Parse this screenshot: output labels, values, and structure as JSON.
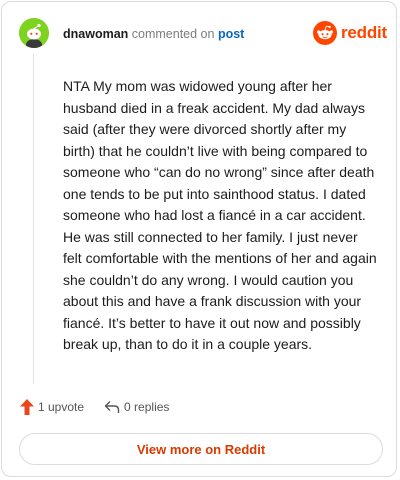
{
  "header": {
    "username": "dnawoman",
    "action_text": "commented on",
    "post_link": "post"
  },
  "brand": {
    "name": "reddit",
    "icon": "reddit-logo-icon",
    "color": "#ff4500"
  },
  "avatar": {
    "icon": "snoo-avatar-icon",
    "color": "#7ed321"
  },
  "comment": {
    "text": "NTA My mom was widowed young after her husband died in a freak accident. My dad always said (after they were divorced shortly after my birth) that he couldn’t live with being compared to someone who “can do no wrong” since after death one tends to be put into sainthood status. I dated someone who had lost a fiancé in a car accident. He was still connected to her family. I just never felt comfortable with the mentions of her and again she couldn’t do any wrong. I would caution you about this and have a frank discussion with your fiancé. It’s better to have it out now and possibly break up, than to do it in a couple years."
  },
  "actions": {
    "upvote_label": "1 upvote",
    "upvote_icon": "upvote-arrow-icon",
    "replies_label": "0 replies",
    "replies_icon": "reply-arrow-icon"
  },
  "footer": {
    "view_more_label": "View more on Reddit"
  }
}
